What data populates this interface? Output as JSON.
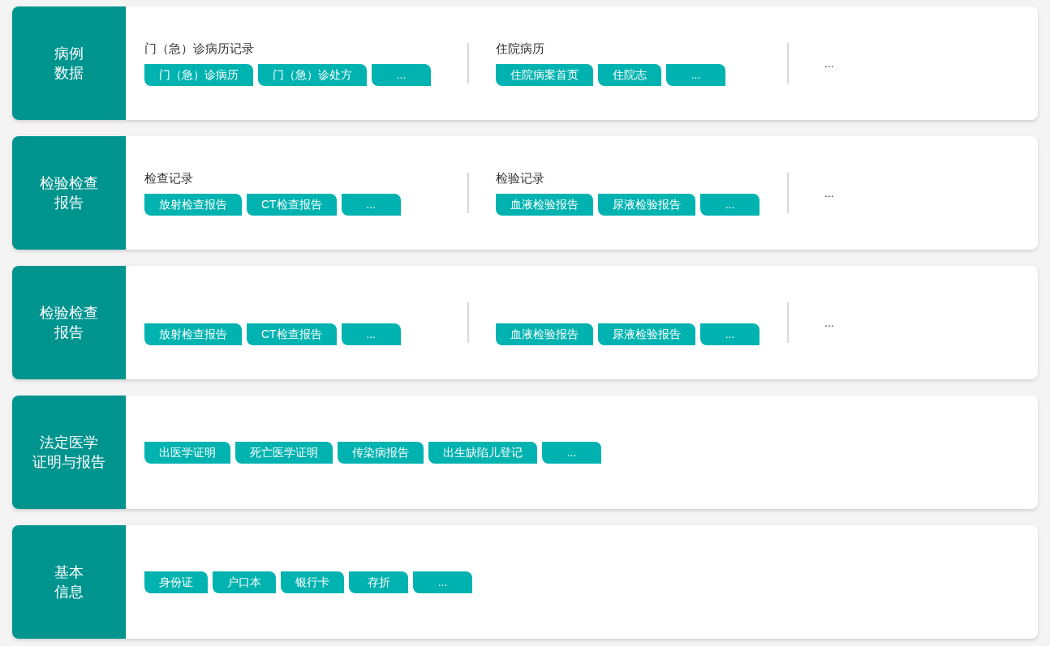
{
  "sections": [
    {
      "title": [
        "病例",
        "数据"
      ],
      "groups": [
        {
          "label": "门（急）诊病历记录",
          "tags": [
            "门（急）诊病历",
            "门（急）诊处方",
            "..."
          ]
        },
        {
          "label": "住院病历",
          "tags": [
            "住院病案首页",
            "住院志",
            "..."
          ]
        }
      ],
      "more": "..."
    },
    {
      "title": [
        "检验检查",
        "报告"
      ],
      "groups": [
        {
          "label": "检查记录",
          "tags": [
            "放射检查报告",
            "CT检查报告",
            "..."
          ]
        },
        {
          "label": "检验记录",
          "tags": [
            "血液检验报告",
            "尿液检验报告",
            "..."
          ]
        }
      ],
      "more": "..."
    },
    {
      "title": [
        "检验检查",
        "报告"
      ],
      "groups": [
        {
          "tags": [
            "放射检查报告",
            "CT检查报告",
            "..."
          ]
        },
        {
          "tags": [
            "血液检验报告",
            "尿液检验报告",
            "..."
          ]
        }
      ],
      "more": "..."
    },
    {
      "title": [
        "法定医学",
        "证明与报告"
      ],
      "groups": [
        {
          "tags": [
            "出医学证明",
            "死亡医学证明",
            "传染病报告",
            "出生缺陷儿登记",
            "..."
          ]
        }
      ]
    },
    {
      "title": [
        "基本",
        "信息"
      ],
      "groups": [
        {
          "tags": [
            "身份证",
            "户口本",
            "银行卡",
            "存折",
            "..."
          ]
        }
      ]
    }
  ]
}
